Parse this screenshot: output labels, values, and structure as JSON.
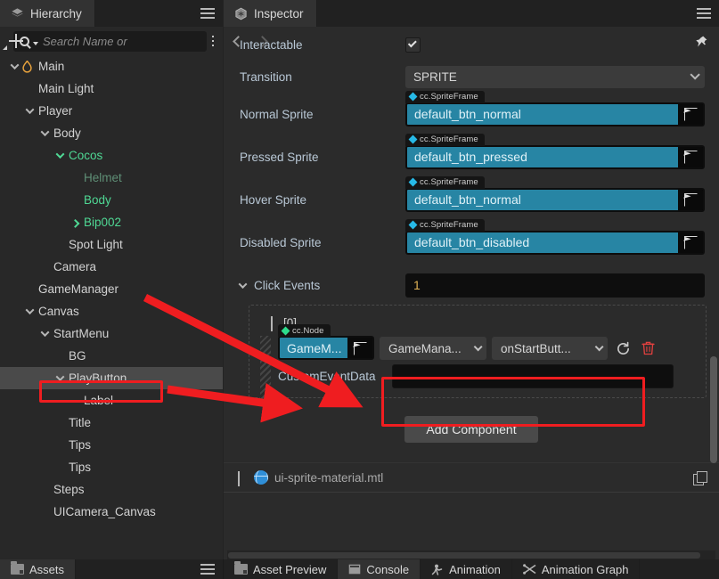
{
  "hierarchy": {
    "tab_label": "Hierarchy",
    "tab_icon": "layers-icon",
    "menu_icon": "hamburger-icon",
    "toolbar": {
      "add_icon": "plus-icon",
      "search_placeholder": "Search Name or ",
      "search_value": "",
      "search_icon": "search-icon",
      "list_icon": "list-options-icon"
    },
    "nodes": [
      {
        "label": "Main",
        "depth": 0,
        "arrow": "down",
        "icon": "flame-icon",
        "color": "normal",
        "selected": false
      },
      {
        "label": "Main Light",
        "depth": 1,
        "arrow": "none",
        "icon": "",
        "color": "normal",
        "selected": false
      },
      {
        "label": "Player",
        "depth": 1,
        "arrow": "down",
        "icon": "",
        "color": "normal",
        "selected": false
      },
      {
        "label": "Body",
        "depth": 2,
        "arrow": "down",
        "icon": "",
        "color": "normal",
        "selected": false
      },
      {
        "label": "Cocos",
        "depth": 3,
        "arrow": "down",
        "icon": "",
        "color": "green",
        "selected": false
      },
      {
        "label": "Helmet",
        "depth": 4,
        "arrow": "none",
        "icon": "",
        "color": "dim",
        "selected": false
      },
      {
        "label": "Body",
        "depth": 4,
        "arrow": "none",
        "icon": "",
        "color": "green",
        "selected": false
      },
      {
        "label": "Bip002",
        "depth": 4,
        "arrow": "right",
        "icon": "",
        "color": "green",
        "selected": false
      },
      {
        "label": "Spot Light",
        "depth": 3,
        "arrow": "none",
        "icon": "",
        "color": "normal",
        "selected": false
      },
      {
        "label": "Camera",
        "depth": 2,
        "arrow": "none",
        "icon": "",
        "color": "normal",
        "selected": false
      },
      {
        "label": "GameManager",
        "depth": 1,
        "arrow": "none",
        "icon": "",
        "color": "normal",
        "selected": false
      },
      {
        "label": "Canvas",
        "depth": 1,
        "arrow": "down",
        "icon": "",
        "color": "normal",
        "selected": false
      },
      {
        "label": "StartMenu",
        "depth": 2,
        "arrow": "down",
        "icon": "",
        "color": "normal",
        "selected": false
      },
      {
        "label": "BG",
        "depth": 3,
        "arrow": "none",
        "icon": "",
        "color": "normal",
        "selected": false
      },
      {
        "label": "PlayButton",
        "depth": 3,
        "arrow": "down",
        "icon": "",
        "color": "normal",
        "selected": true
      },
      {
        "label": "Label",
        "depth": 4,
        "arrow": "none",
        "icon": "",
        "color": "normal",
        "selected": false
      },
      {
        "label": "Title",
        "depth": 3,
        "arrow": "none",
        "icon": "",
        "color": "normal",
        "selected": false
      },
      {
        "label": "Tips",
        "depth": 3,
        "arrow": "none",
        "icon": "",
        "color": "normal",
        "selected": false
      },
      {
        "label": "Tips",
        "depth": 3,
        "arrow": "none",
        "icon": "",
        "color": "normal",
        "selected": false
      },
      {
        "label": "Steps",
        "depth": 2,
        "arrow": "none",
        "icon": "",
        "color": "normal",
        "selected": false
      },
      {
        "label": "UICamera_Canvas",
        "depth": 2,
        "arrow": "none",
        "icon": "",
        "color": "normal",
        "selected": false
      }
    ]
  },
  "inspector": {
    "tab_label": "Inspector",
    "tab_icon": "inspector-cube-icon",
    "menu_icon": "hamburger-icon",
    "nav": {
      "back_icon": "chevron-left-icon",
      "forward_icon": "chevron-right-icon",
      "pin_icon": "pin-icon"
    },
    "interactable": {
      "label": "Interactable",
      "checked": true
    },
    "transition": {
      "label": "Transition",
      "value": "SPRITE",
      "chevron_icon": "chevron-down-icon"
    },
    "sprites": [
      {
        "label": "Normal Sprite",
        "type": "cc.SpriteFrame",
        "value": "default_btn_normal",
        "pick_icon": "select-asset-icon"
      },
      {
        "label": "Pressed Sprite",
        "type": "cc.SpriteFrame",
        "value": "default_btn_pressed",
        "pick_icon": "select-asset-icon"
      },
      {
        "label": "Hover Sprite",
        "type": "cc.SpriteFrame",
        "value": "default_btn_normal",
        "pick_icon": "select-asset-icon"
      },
      {
        "label": "Disabled Sprite",
        "type": "cc.SpriteFrame",
        "value": "default_btn_disabled",
        "pick_icon": "select-asset-icon"
      }
    ],
    "click_events": {
      "label": "Click Events",
      "count": "1",
      "fold_icon": "chevron-down-icon",
      "entry": {
        "index_label": "[0]",
        "fold_icon": "chevron-down-icon",
        "drag_handle": "drag-handle-icon",
        "target_type": "cc.Node",
        "target_value": "GameM...",
        "pick_icon": "select-asset-icon",
        "component_value": "GameMana...",
        "handler_value": "onStartButt...",
        "refresh_icon": "refresh-icon",
        "delete_icon": "trash-icon",
        "custom_event_label": "CustomEventData",
        "custom_event_value": ""
      }
    },
    "add_component_label": "Add Component",
    "material": {
      "name": "ui-sprite-material.mtl",
      "fold_icon": "chevron-right-icon",
      "asset_icon": "material-globe-icon",
      "copy_icon": "copy-icon"
    }
  },
  "bottom_tabs": {
    "left": [
      {
        "label": "Assets",
        "icon": "folder-icon",
        "active": true
      }
    ],
    "right": [
      {
        "label": "Asset Preview",
        "icon": "folder-icon",
        "active": false
      },
      {
        "label": "Console",
        "icon": "console-icon",
        "active": true
      },
      {
        "label": "Animation",
        "icon": "animation-icon",
        "active": false
      },
      {
        "label": "Animation Graph",
        "icon": "animation-graph-icon",
        "active": false
      }
    ],
    "menu_icon": "hamburger-icon"
  },
  "colors": {
    "asset_teal": "#2785a4",
    "annotation_red": "#ef1d20",
    "prefab_green": "#4fd894",
    "number_gold": "#e0b257",
    "label_blue": "#b9c8d6"
  }
}
